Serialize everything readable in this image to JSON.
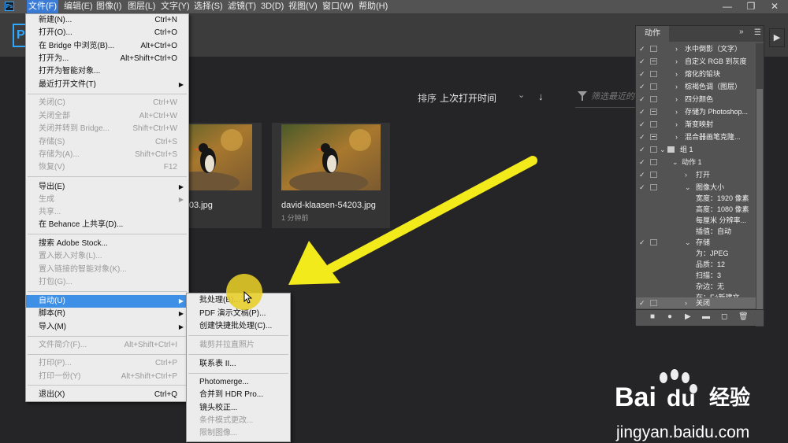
{
  "menubar": {
    "app_icon": "Ps",
    "items": [
      "文件(F)",
      "编辑(E)",
      "图像(I)",
      "图层(L)",
      "文字(Y)",
      "选择(S)",
      "滤镜(T)",
      "3D(D)",
      "视图(V)",
      "窗口(W)",
      "帮助(H)"
    ],
    "window_controls": {
      "minimize": "—",
      "restore": "❐",
      "close": "✕"
    }
  },
  "logo": "P",
  "file_menu": {
    "new": {
      "label": "新建(N)...",
      "shortcut": "Ctrl+N"
    },
    "open": {
      "label": "打开(O)...",
      "shortcut": "Ctrl+O"
    },
    "browse_bridge": {
      "label": "在 Bridge 中浏览(B)...",
      "shortcut": "Alt+Ctrl+O"
    },
    "open_as": {
      "label": "打开为...",
      "shortcut": "Alt+Shift+Ctrl+O"
    },
    "open_smart": {
      "label": "打开为智能对象..."
    },
    "recent": {
      "label": "最近打开文件(T)"
    },
    "close": {
      "label": "关闭(C)",
      "shortcut": "Ctrl+W"
    },
    "close_all": {
      "label": "关闭全部",
      "shortcut": "Alt+Ctrl+W"
    },
    "close_bridge": {
      "label": "关闭并转到 Bridge...",
      "shortcut": "Shift+Ctrl+W"
    },
    "save": {
      "label": "存储(S)",
      "shortcut": "Ctrl+S"
    },
    "save_as": {
      "label": "存储为(A)...",
      "shortcut": "Shift+Ctrl+S"
    },
    "revert": {
      "label": "恢复(V)",
      "shortcut": "F12"
    },
    "export": {
      "label": "导出(E)"
    },
    "generate": {
      "label": "生成"
    },
    "share": {
      "label": "共享..."
    },
    "behance": {
      "label": "在 Behance 上共享(D)..."
    },
    "adobe_stock": {
      "label": "搜索 Adobe Stock..."
    },
    "place_embedded": {
      "label": "置入嵌入对象(L)..."
    },
    "place_linked": {
      "label": "置入链接的智能对象(K)..."
    },
    "package": {
      "label": "打包(G)..."
    },
    "automate": {
      "label": "自动(U)"
    },
    "scripts": {
      "label": "脚本(R)"
    },
    "import": {
      "label": "导入(M)"
    },
    "file_info": {
      "label": "文件简介(F)...",
      "shortcut": "Alt+Shift+Ctrl+I"
    },
    "print": {
      "label": "打印(P)...",
      "shortcut": "Ctrl+P"
    },
    "print_one": {
      "label": "打印一份(Y)",
      "shortcut": "Alt+Shift+Ctrl+P"
    },
    "exit": {
      "label": "退出(X)",
      "shortcut": "Ctrl+Q"
    }
  },
  "automate_submenu": {
    "batch": "批处理(B)...",
    "pdf": "PDF 演示文稿(P)...",
    "droplet": "创建快捷批处理(C)...",
    "crop_straighten": "裁剪并拉直照片",
    "contact_sheet": "联系表 II...",
    "photomerge": "Photomerge...",
    "hdr": "合并到 HDR Pro...",
    "lens": "镜头校正...",
    "conditional": "条件模式更改...",
    "fit_image": "限制图像..."
  },
  "home": {
    "sort_label": "排序",
    "sort_value": "上次打开时间",
    "filter_placeholder": "筛选最近的",
    "files": [
      {
        "name": "david-klaasen-54203.jpg",
        "name_visible": "asen-54203.jpg",
        "time": ""
      },
      {
        "name": "david-klaasen-54203.jpg",
        "time": "1 分钟前"
      }
    ]
  },
  "actions_panel": {
    "tab": "动作",
    "collapse": "»",
    "rows": [
      {
        "text": "水中倒影（文字）",
        "check": "✓",
        "dialog": false
      },
      {
        "text": "自定义 RGB 到灰度",
        "check": "✓",
        "dialog": true
      },
      {
        "text": "熔化的铅块",
        "check": "✓",
        "dialog": false
      },
      {
        "text": "棕褐色调（图层）",
        "check": "✓",
        "dialog": false
      },
      {
        "text": "四分颜色",
        "check": "✓",
        "dialog": false
      },
      {
        "text": "存储为 Photoshop...",
        "check": "✓",
        "dialog": true
      },
      {
        "text": "渐变映射",
        "check": "✓",
        "dialog": false
      },
      {
        "text": "混合器画笔克隆...",
        "check": "✓",
        "dialog": true
      },
      {
        "text": "组 1",
        "check": "✓",
        "dialog": false
      },
      {
        "text": "动作 1",
        "check": "✓",
        "dialog": false
      },
      {
        "text": "打开",
        "check": "✓",
        "dialog": false
      },
      {
        "text": "图像大小",
        "check": "✓",
        "dialog": false
      },
      {
        "text": "宽度：1920 像素",
        "check": "",
        "dialog": false
      },
      {
        "text": "高度：1080 像素",
        "check": "",
        "dialog": false
      },
      {
        "text": "每厘米 分辨率...",
        "check": "",
        "dialog": false
      },
      {
        "text": "插值：自动",
        "check": "",
        "dialog": false
      },
      {
        "text": "存储",
        "check": "✓",
        "dialog": false
      },
      {
        "text": "为：JPEG",
        "check": "",
        "dialog": false
      },
      {
        "text": "品质：12",
        "check": "",
        "dialog": false
      },
      {
        "text": "扫描：3",
        "check": "",
        "dialog": false
      },
      {
        "text": "杂边：无",
        "check": "",
        "dialog": false
      },
      {
        "text": "在：F:\\新建文...",
        "check": "",
        "dialog": false
      },
      {
        "text": "关闭",
        "check": "✓",
        "dialog": false
      }
    ],
    "buttons": [
      "■",
      "●",
      "▶",
      "▬",
      "◻",
      "🗑"
    ]
  },
  "watermark": {
    "brand": "Bai",
    "brand2": "du",
    "product": "经验",
    "url": "jingyan.baidu.com"
  },
  "colors": {
    "menu_highlight": "#3e8fe6",
    "arrow": "#f2ea1a",
    "ps_blue": "#31a8ff"
  }
}
